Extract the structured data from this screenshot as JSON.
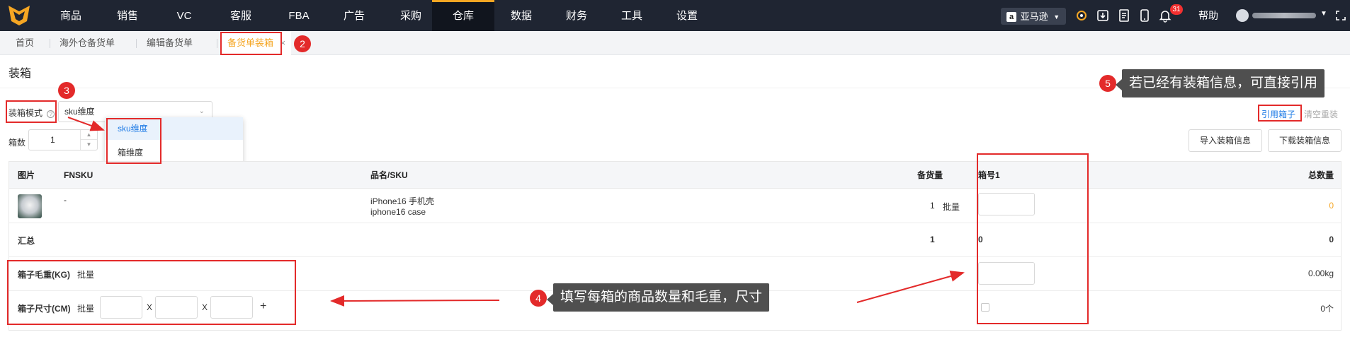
{
  "nav": {
    "items": [
      "商品",
      "销售",
      "VC",
      "客服",
      "FBA",
      "广告",
      "采购",
      "仓库",
      "数据",
      "财务",
      "工具",
      "设置"
    ],
    "active_index": 7,
    "marketplace": "亚马逊",
    "notification_count": "31",
    "help": "帮助"
  },
  "tabs": [
    "首页",
    "海外仓备货单",
    "编辑备货单",
    "备货单装箱"
  ],
  "page_title": "装箱",
  "form": {
    "mode_label": "装箱模式",
    "mode_value": "sku维度",
    "mode_options": [
      "sku维度",
      "箱维度"
    ],
    "box_count_label": "箱数",
    "box_count_value": "1"
  },
  "actions": {
    "quote_box": "引用箱子",
    "clear_box": "清空重装",
    "import_box": "导入装箱信息",
    "download_box": "下载装箱信息"
  },
  "table": {
    "headers": {
      "image": "图片",
      "fnsku": "FNSKU",
      "name_sku": "品名/SKU",
      "stock_qty": "备货量",
      "box1": "箱号1",
      "total": "总数量"
    },
    "row": {
      "fnsku": "-",
      "name": "iPhone16 手机壳",
      "sku": "iphone16 case",
      "stock_qty": "1",
      "batch": "批量",
      "total": "0"
    },
    "summary": {
      "label": "汇总",
      "stock_qty": "1",
      "box1": "0",
      "total": "0"
    },
    "weight": {
      "label": "箱子毛重(KG)",
      "batch": "批量",
      "total": "0.00kg"
    },
    "size": {
      "label": "箱子尺寸(CM)",
      "batch": "批量",
      "x": "X",
      "plus": "+",
      "total": "0个"
    }
  },
  "annotations": {
    "n2": "2",
    "n3": "3",
    "n4": "4",
    "n5": "5",
    "tip4": "填写每箱的商品数量和毛重，尺寸",
    "tip5": "若已经有装箱信息，可直接引用"
  },
  "colors": {
    "nav_bg": "#1f2532",
    "accent": "#f5a623",
    "link": "#1e7be6",
    "annotation": "#e32a2a"
  }
}
